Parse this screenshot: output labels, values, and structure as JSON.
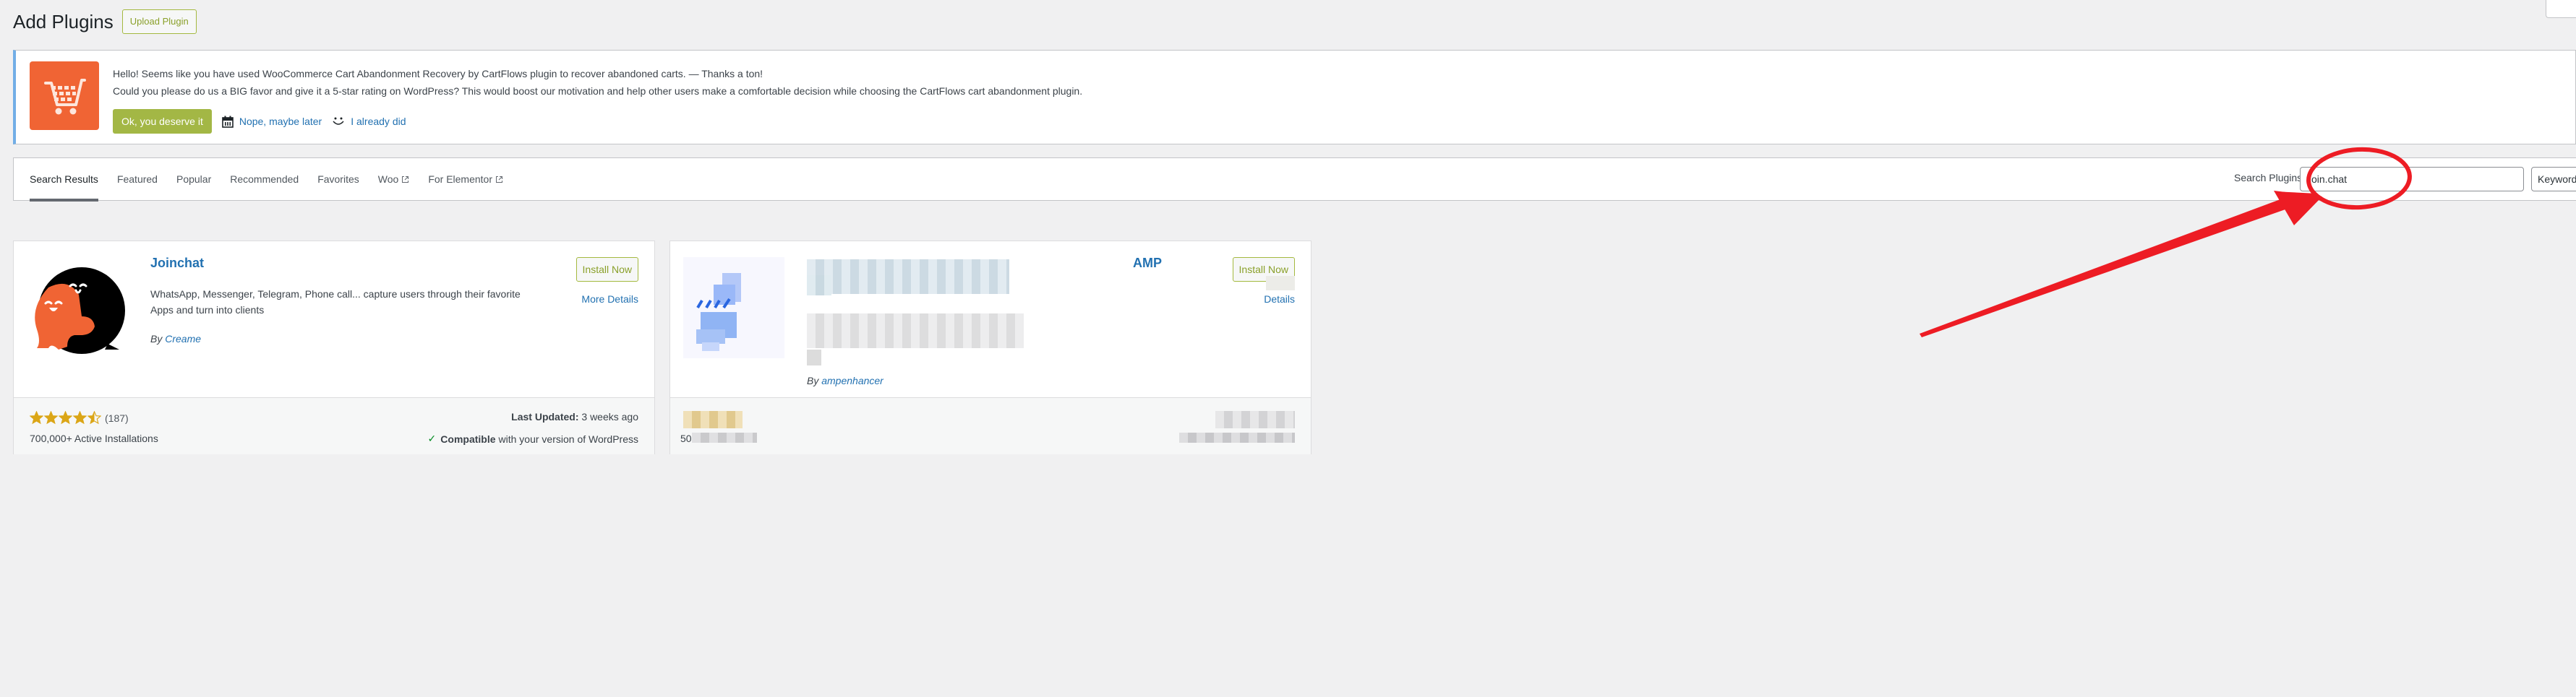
{
  "header": {
    "title": "Add Plugins",
    "upload_label": "Upload Plugin"
  },
  "notice": {
    "logo_icon": "shopping-cart-icon",
    "line1": "Hello! Seems like you have used WooCommerce Cart Abandonment Recovery by CartFlows plugin to recover abandoned carts. — Thanks a ton!",
    "line2": "Could you please do us a BIG favor and give it a 5-star rating on WordPress? This would boost our motivation and help other users make a comfortable decision while choosing the CartFlows cart abandonment plugin.",
    "ok_label": "Ok, you deserve it",
    "later_label": "Nope, maybe later",
    "later_icon": "calendar-icon",
    "done_label": "I already did",
    "done_icon": "smiley-icon",
    "accent": "#72aee6",
    "logo_color": "#f06434",
    "ok_color": "#a3b745"
  },
  "filter": {
    "tabs": [
      {
        "label": "Search Results",
        "active": true
      },
      {
        "label": "Featured"
      },
      {
        "label": "Popular"
      },
      {
        "label": "Recommended"
      },
      {
        "label": "Favorites"
      },
      {
        "label": "Woo",
        "external": true
      },
      {
        "label": "For Elementor",
        "external": true
      }
    ],
    "search_label": "Search Plugins",
    "search_value": "Join.chat",
    "search_type": "Keyword"
  },
  "plugins": [
    {
      "name": "Joinchat",
      "description": "WhatsApp, Messenger, Telegram, Phone call... capture users through their favorite Apps and turn into clients",
      "by_label": "By",
      "author": "Creame",
      "install_label": "Install Now",
      "details_label": "More Details",
      "rating_stars": 4.5,
      "num_ratings": "(187)",
      "installs": "700,000+ Active Installations",
      "last_updated_label": "Last Updated:",
      "last_updated_value": "3 weeks ago",
      "compat_strong": "Compatible",
      "compat_rest": "with your version of WordPress"
    },
    {
      "name_visible_fragment": "AMP",
      "by_label": "By",
      "author": "ampenhancer",
      "install_label": "Install Now",
      "details_label": "Details",
      "installs_fragment": "50",
      "blurred": true
    }
  ],
  "annotation": {
    "color": "#ed1c24",
    "shapes": [
      "circle-around-search-input",
      "arrow-pointing-to-search-input"
    ]
  }
}
